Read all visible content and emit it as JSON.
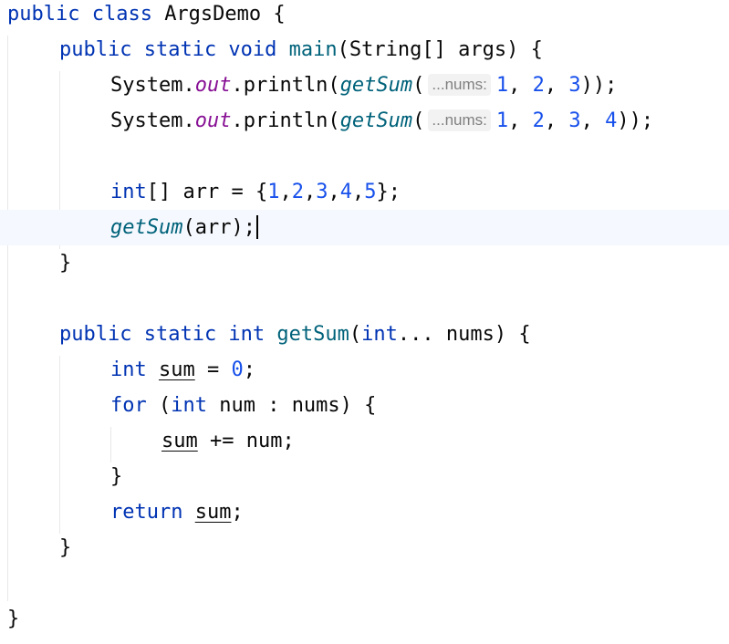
{
  "editor": {
    "language": "Java",
    "current_line_index": 6,
    "lines": [
      {
        "segments": [
          {
            "t": "public class ",
            "c": "kw"
          },
          {
            "t": "ArgsDemo {",
            "c": "plain"
          }
        ]
      },
      {
        "segments": [
          {
            "t": "public static void ",
            "c": "kw"
          },
          {
            "t": "main",
            "c": "mdecl"
          },
          {
            "t": "(String[] args) {",
            "c": "plain"
          }
        ]
      },
      {
        "segments": [
          {
            "t": "System.",
            "c": "plain"
          },
          {
            "t": "out",
            "c": "fld"
          },
          {
            "t": ".println(",
            "c": "plain"
          },
          {
            "t": "getSum",
            "c": "mcall"
          },
          {
            "t": "(",
            "c": "plain"
          },
          {
            "hint": "...nums:"
          },
          {
            "t": "1",
            "c": "num"
          },
          {
            "t": ", ",
            "c": "plain"
          },
          {
            "t": "2",
            "c": "num"
          },
          {
            "t": ", ",
            "c": "plain"
          },
          {
            "t": "3",
            "c": "num"
          },
          {
            "t": "));",
            "c": "plain"
          }
        ]
      },
      {
        "segments": [
          {
            "t": "System.",
            "c": "plain"
          },
          {
            "t": "out",
            "c": "fld"
          },
          {
            "t": ".println(",
            "c": "plain"
          },
          {
            "t": "getSum",
            "c": "mcall"
          },
          {
            "t": "(",
            "c": "plain"
          },
          {
            "hint": "...nums:"
          },
          {
            "t": "1",
            "c": "num"
          },
          {
            "t": ", ",
            "c": "plain"
          },
          {
            "t": "2",
            "c": "num"
          },
          {
            "t": ", ",
            "c": "plain"
          },
          {
            "t": "3",
            "c": "num"
          },
          {
            "t": ", ",
            "c": "plain"
          },
          {
            "t": "4",
            "c": "num"
          },
          {
            "t": "));",
            "c": "plain"
          }
        ]
      },
      {
        "segments": []
      },
      {
        "segments": [
          {
            "t": "int",
            "c": "kw"
          },
          {
            "t": "[] arr = {",
            "c": "plain"
          },
          {
            "t": "1",
            "c": "num"
          },
          {
            "t": ",",
            "c": "plain"
          },
          {
            "t": "2",
            "c": "num"
          },
          {
            "t": ",",
            "c": "plain"
          },
          {
            "t": "3",
            "c": "num"
          },
          {
            "t": ",",
            "c": "plain"
          },
          {
            "t": "4",
            "c": "num"
          },
          {
            "t": ",",
            "c": "plain"
          },
          {
            "t": "5",
            "c": "num"
          },
          {
            "t": "};",
            "c": "plain"
          }
        ]
      },
      {
        "segments": [
          {
            "t": "getSum",
            "c": "mcall"
          },
          {
            "t": "(arr);",
            "c": "plain"
          },
          {
            "caret": true
          }
        ]
      },
      {
        "segments": [
          {
            "t": "}",
            "c": "plain"
          }
        ]
      },
      {
        "segments": []
      },
      {
        "segments": [
          {
            "t": "public static int ",
            "c": "kw"
          },
          {
            "t": "getSum",
            "c": "mdecl"
          },
          {
            "t": "(",
            "c": "plain"
          },
          {
            "t": "int",
            "c": "kw"
          },
          {
            "t": "... nums) {",
            "c": "plain"
          }
        ]
      },
      {
        "segments": [
          {
            "t": "int ",
            "c": "kw"
          },
          {
            "t": "sum",
            "c": "plain ul"
          },
          {
            "t": " = ",
            "c": "plain"
          },
          {
            "t": "0",
            "c": "num"
          },
          {
            "t": ";",
            "c": "plain"
          }
        ]
      },
      {
        "segments": [
          {
            "t": "for ",
            "c": "kw"
          },
          {
            "t": "(",
            "c": "plain"
          },
          {
            "t": "int ",
            "c": "kw"
          },
          {
            "t": "num : nums) {",
            "c": "plain"
          }
        ]
      },
      {
        "segments": [
          {
            "t": "sum",
            "c": "plain ul"
          },
          {
            "t": " += num;",
            "c": "plain"
          }
        ]
      },
      {
        "segments": [
          {
            "t": "}",
            "c": "plain"
          }
        ]
      },
      {
        "segments": [
          {
            "t": "return ",
            "c": "kw"
          },
          {
            "t": "sum",
            "c": "plain ul"
          },
          {
            "t": ";",
            "c": "plain"
          }
        ]
      },
      {
        "segments": [
          {
            "t": "}",
            "c": "plain"
          }
        ]
      },
      {
        "segments": []
      },
      {
        "segments": [
          {
            "t": "}",
            "c": "plain"
          }
        ]
      }
    ],
    "gutter_icon": "intention-bulb-icon"
  }
}
